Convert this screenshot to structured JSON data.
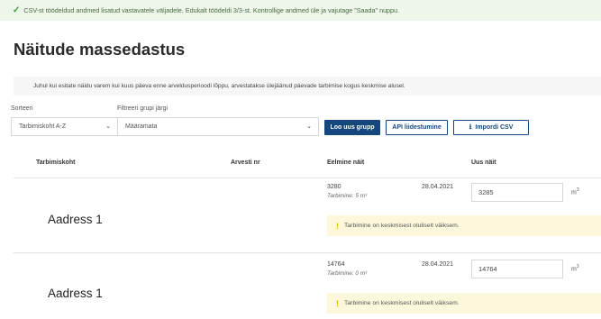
{
  "banner": {
    "icon": "check-icon",
    "text": "CSV-st töödeldud andmed lisatud vastavatele väljadele. Edukalt töödeldi 3/3-st. Kontrollige andmed üle ja vajutage \"Saada\" nuppu."
  },
  "page": {
    "title": "Näitude massedastus"
  },
  "info": "Juhul kui esitate näidu varem kui kuus päeva enne arveldusperioodi lõppu, arvestatakse ülejäänud päevade tarbimise kogus keskmise alusel.",
  "filters": {
    "sort_label": "Sorteeri",
    "sort_value": "Tarbimiskoht A-Z",
    "group_label": "Filtreeri grupi järgi",
    "group_value": "Määramata"
  },
  "actions": {
    "new_group": "Loo uus grupp",
    "api": "API liidestumine",
    "import_csv": "Impordi CSV"
  },
  "table": {
    "headers": {
      "location": "Tarbimiskoht",
      "meter": "Arvesti nr",
      "prev": "Eelmine näit",
      "new": "Uus näit"
    },
    "rows": [
      {
        "address": "Aadress 1",
        "prev_value": "3280",
        "consumption": "Tarbimine: 5 m³",
        "prev_date": "28.04.2021",
        "new_value": "3285",
        "unit": "m",
        "unit_sup": "3",
        "warning": "Tarbimine on keskmisest oluliselt väiksem."
      },
      {
        "address": "Aadress 1",
        "prev_value": "14764",
        "consumption": "Tarbimine: 0 m³",
        "prev_date": "28.04.2021",
        "new_value": "14764",
        "unit": "m",
        "unit_sup": "3",
        "warning": "Tarbimine on keskmisest oluliselt väiksem."
      }
    ]
  },
  "colors": {
    "primary": "#15467e",
    "success_bg": "#eef6ea",
    "success_icon": "#3f9b3a",
    "warning_bg": "#fdf8dc",
    "warning_icon": "#e5b400"
  }
}
